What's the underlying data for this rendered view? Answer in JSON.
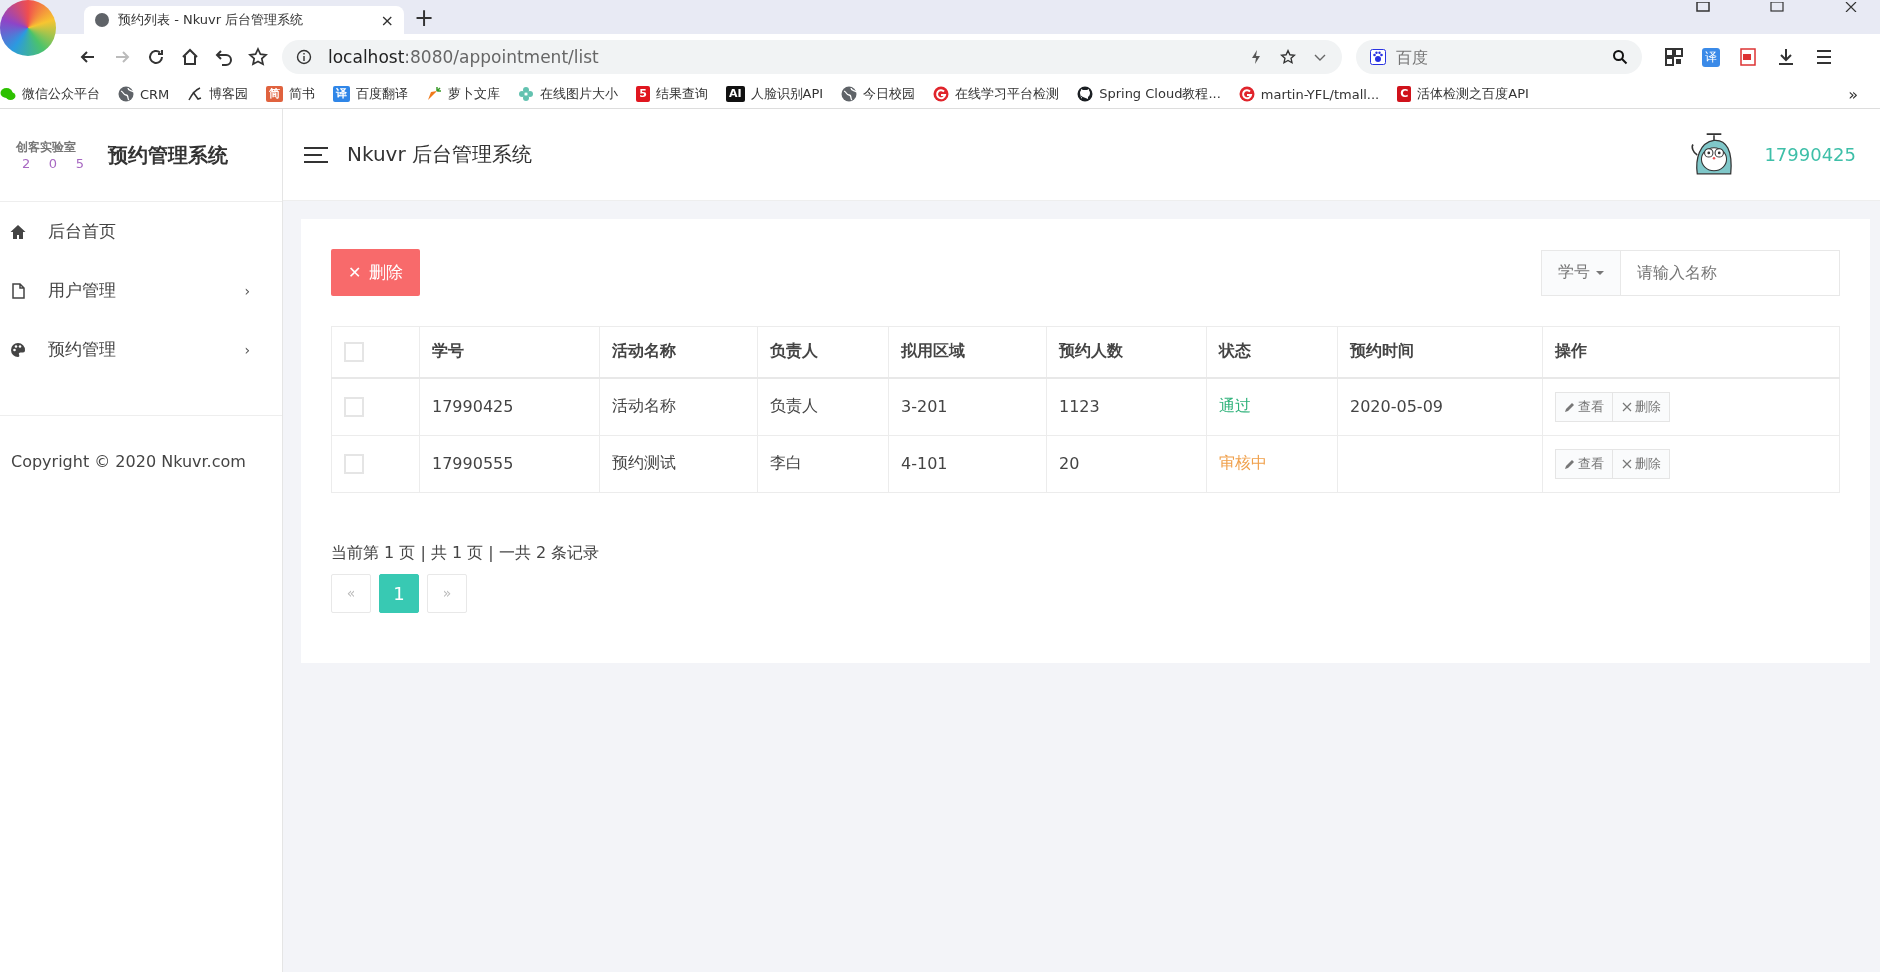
{
  "browser": {
    "tab_title": "预约列表 - Nkuvr 后台管理系统",
    "tab_close": "×",
    "new_tab": "+",
    "url_host": "localhost",
    "url_path": ":8080/appointment/list",
    "search_placeholder": "百度",
    "translate_badge": "译",
    "bookmarks": [
      {
        "kind": "wechat",
        "label": "微信公众平台"
      },
      {
        "kind": "globe",
        "label": "CRM"
      },
      {
        "kind": "pen",
        "label": "博客园"
      },
      {
        "kind": "badge",
        "badge": "简",
        "color": "#e0623e",
        "label": "简书"
      },
      {
        "kind": "badge",
        "badge": "译",
        "color": "#2f86e8",
        "label": "百度翻译"
      },
      {
        "kind": "carrot",
        "label": "萝卜文库"
      },
      {
        "kind": "flower",
        "label": "在线图片大小"
      },
      {
        "kind": "badge",
        "badge": "5",
        "color": "#e0161f",
        "label": "结果查询"
      },
      {
        "kind": "badge",
        "badge": "AI",
        "color": "#111111",
        "label": "人脸识别API"
      },
      {
        "kind": "globe",
        "label": "今日校园"
      },
      {
        "kind": "ring",
        "label": "在线学习平台检测"
      },
      {
        "kind": "github",
        "label": "Spring Cloud教程..."
      },
      {
        "kind": "ring",
        "label": "martin-YFL/tmall..."
      },
      {
        "kind": "badge",
        "badge": "C",
        "color": "#d0121b",
        "label": "活体检测之百度API"
      }
    ],
    "more": "»"
  },
  "logo": {
    "line1": "创客实验室",
    "line2": [
      "2",
      "0",
      "5"
    ],
    "title": "预约管理系统"
  },
  "header": {
    "title": "Nkuvr 后台管理系统",
    "user": "17990425"
  },
  "sidebar": {
    "items": [
      {
        "kind": "home",
        "label": "后台首页",
        "has_submenu": false
      },
      {
        "kind": "file",
        "label": "用户管理",
        "has_submenu": true
      },
      {
        "kind": "palette",
        "label": "预约管理",
        "has_submenu": true
      }
    ],
    "submenu_mark": "›",
    "copyright": "Copyright © 2020 Nkuvr.com"
  },
  "toolbar": {
    "delete_icon": "✕",
    "delete_label": "删除",
    "search_field": "学号",
    "search_placeholder": "请输入名称"
  },
  "table": {
    "header_checked": false,
    "columns": [
      "学号",
      "活动名称",
      "负责人",
      "拟用区域",
      "预约人数",
      "状态",
      "预约时间",
      "操作"
    ],
    "rows": [
      {
        "checked": false,
        "id": "17990425",
        "activity": "活动名称",
        "owner": "负责人",
        "area": "3-201",
        "count": "1123",
        "status": {
          "text": "通过",
          "color": "#2fb27a"
        },
        "time": "2020-05-09",
        "view": "查看",
        "delete": "删除"
      },
      {
        "checked": false,
        "id": "17990555",
        "activity": "预约测试",
        "owner": "李白",
        "area": "4-101",
        "count": "20",
        "status": {
          "text": "审核中",
          "color": "#f0a04b"
        },
        "view": "查看",
        "delete": "删除"
      }
    ]
  },
  "pagination": {
    "summary": "当前第 1 页 | 共 1 页 | 一共 2 条记录",
    "pages": [
      {
        "label": "«",
        "selected": false,
        "disabled": true
      },
      {
        "label": "1",
        "selected": true,
        "disabled": false
      },
      {
        "label": "»",
        "selected": false,
        "disabled": true
      }
    ]
  }
}
